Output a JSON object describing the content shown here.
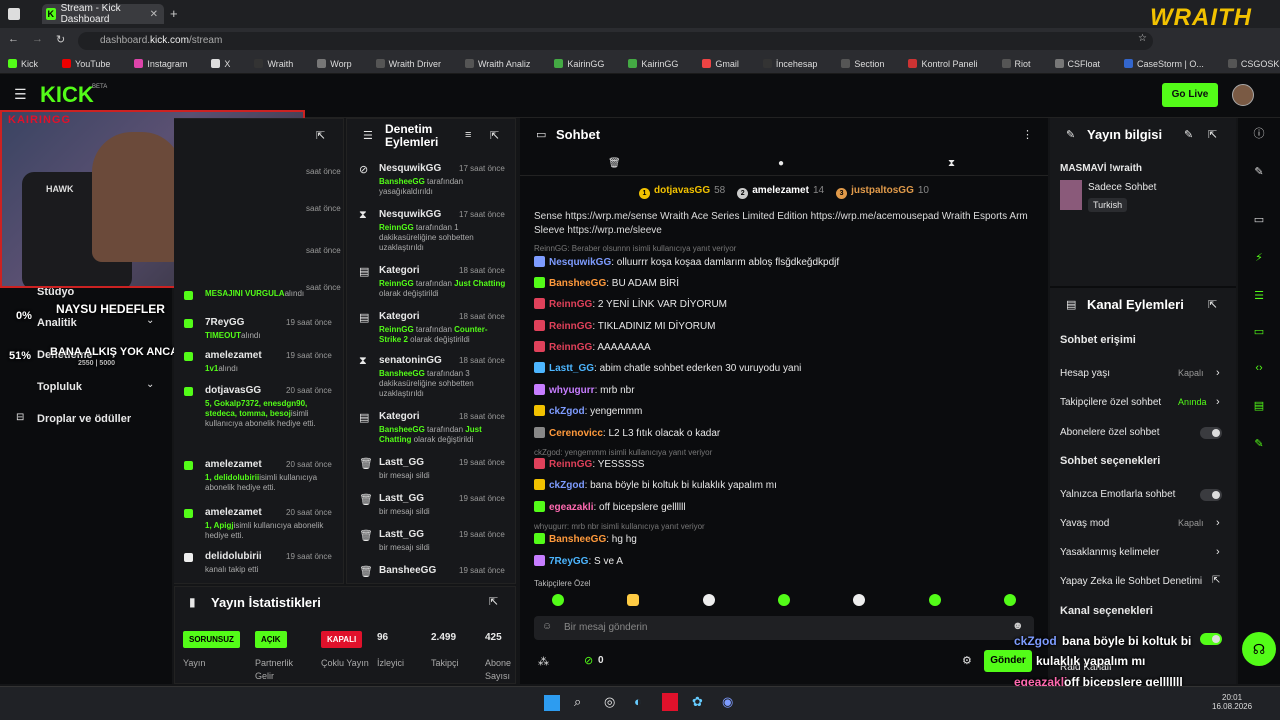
{
  "browser": {
    "tab_title": "Stream - Kick Dashboard",
    "url_prefix": "dashboard.",
    "url_domain": "kick.com",
    "url_path": "/stream",
    "bookmarks": [
      "Kick",
      "YouTube",
      "Instagram",
      "X",
      "Wraith",
      "Worp",
      "Wraith Driver",
      "Wraith Analiz",
      "KairinGG",
      "KairinGG",
      "Gmail",
      "İncehesap",
      "Section",
      "Kontrol Paneli",
      "Riot",
      "CSFloat",
      "CaseStorm | O...",
      "CSGOSKINS.GG",
      "quickabdest",
      "Team Venture |...",
      "Matchmaking"
    ]
  },
  "header": {
    "logo": "KICK",
    "beta": "BETA",
    "go_live": "Go Live",
    "overlay_brand": "WRAITH"
  },
  "cam": {
    "label": "KAIRINGG",
    "hawk": "HAWK"
  },
  "leftnav": {
    "items": [
      {
        "label": "Stüdyo"
      },
      {
        "label": "Analitik"
      },
      {
        "label": "Denetleme"
      },
      {
        "label": "Topluluk"
      },
      {
        "label": "Droplar ve ödüller"
      }
    ],
    "overlay_goals": "NAYSU HEDEFLER",
    "overlay_pct1": "0%",
    "overlay_pct2": "51%",
    "overlay_alkis": "BANA ALKIŞ YOK ANCA KICK",
    "overlay_sub": "2550 | 5000"
  },
  "activity": {
    "rows": [
      {
        "title": "",
        "sub": "MESAJINI VURGULA",
        "sub2": "alındı",
        "time": ""
      },
      {
        "title": "7ReyGG",
        "sub": "TIMEOUT",
        "sub2": "alındı",
        "time": "19 saat önce"
      },
      {
        "title": "amelezamet",
        "sub": "1v1",
        "sub2": "alındı",
        "time": "19 saat önce"
      },
      {
        "title": "dotjavasGG",
        "sub": "5, Gokalp7372, enesdgn90, stedeca, tomma, besoj",
        "sub2": "isimli kullanıcıya abonelik hediye etti.",
        "time": "20 saat önce"
      },
      {
        "title": "amelezamet",
        "sub": "1, delidolubirii",
        "sub2": "isimli kullanıcıya abonelik hediye etti.",
        "time": "20 saat önce"
      },
      {
        "title": "amelezamet",
        "sub": "1, Apigj",
        "sub2": "isimli kullanıcıya abonelik hediye etti.",
        "time": "20 saat önce"
      },
      {
        "title": "delidolubirii",
        "sub": "",
        "sub2": "kanalı takip etti",
        "time": "19 saat önce"
      }
    ],
    "partial_times": [
      "saat önce",
      "saat önce",
      "saat önce",
      "saat önce"
    ]
  },
  "modlog": {
    "title": "Denetim Eylemleri",
    "rows": [
      {
        "user": "NesquwikGG",
        "time": "17 saat önce",
        "line1": "BansheeGG",
        "line1b": " tarafından yasağı",
        "line2": "kaldırıldı"
      },
      {
        "user": "NesquwikGG",
        "time": "17 saat önce",
        "line1": "ReinnGG",
        "line1b": " tarafından 1 dakika",
        "line2": "süreliğine sohbetten uzaklaştırıldı"
      },
      {
        "user": "Kategori",
        "time": "18 saat önce",
        "line1": "ReinnGG",
        "line1b": " tarafından ",
        "line1c": "Just Chatting",
        "line2": " olarak değiştirildi"
      },
      {
        "user": "Kategori",
        "time": "18 saat önce",
        "line1": "ReinnGG",
        "line1b": " tarafından ",
        "line1c": "Counter-Strike 2",
        "line2": " olarak değiştirildi"
      },
      {
        "user": "senatoninGG",
        "time": "18 saat önce",
        "line1": "BansheeGG",
        "line1b": " tarafından 3 dakika",
        "line2": "süreliğine sohbetten uzaklaştırıldı"
      },
      {
        "user": "Kategori",
        "time": "18 saat önce",
        "line1": "BansheeGG",
        "line1b": " tarafından ",
        "line1c": "Just Chatting",
        "line2": " olarak değiştirildi"
      },
      {
        "user": "Lastt_GG",
        "time": "19 saat önce",
        "line1": "",
        "line1b": "bir mesajı sildi",
        "line2": ""
      },
      {
        "user": "Lastt_GG",
        "time": "19 saat önce",
        "line1": "",
        "line1b": "bir mesajı sildi",
        "line2": ""
      },
      {
        "user": "Lastt_GG",
        "time": "19 saat önce",
        "line1": "",
        "line1b": "bir mesajı sildi",
        "line2": ""
      },
      {
        "user": "BansheeGG",
        "time": "19 saat önce",
        "line1": "",
        "line1b": "",
        "line2": ""
      }
    ]
  },
  "stats": {
    "title": "Yayın İstatistikleri",
    "items": [
      {
        "pill": "SORUNSUZ",
        "label": "Yayın",
        "color": "#53fc18"
      },
      {
        "pill": "AÇIK",
        "label": "Partnerlik Gelir",
        "color": "#53fc18"
      },
      {
        "pill": "KAPALI",
        "label": "Çoklu Yayın",
        "color": "#e0112b"
      },
      {
        "val": "96",
        "label": "İzleyici"
      },
      {
        "val": "2.499",
        "label": "Takipçi"
      },
      {
        "val": "425",
        "label": "Abone Sayısı"
      }
    ]
  },
  "chat": {
    "title": "Sohbet",
    "top_gifters": [
      {
        "name": "dotjavasGG",
        "n": "58"
      },
      {
        "name": "amelezamet",
        "n": "14"
      },
      {
        "name": "justpaltosGG",
        "n": "10"
      }
    ],
    "pinned": "Sense https://wrp.me/sense Wraith Ace Series Limited Edition https://wrp.me/acemousepad Wraith Esports Arm Sleeve https://wrp.me/sleeve",
    "messages": [
      {
        "type": "reply",
        "text": "ReinnGG: Beraber olsunnn isimli kullanıcıya yanıt veriyor"
      },
      {
        "type": "msg",
        "user": "NesquwikGG",
        "color": "#7e9cff",
        "text": ": olluurrr koşa koşaa damlarım abloş flsğdkeğdkpdjf"
      },
      {
        "type": "msg",
        "user": "BansheeGG",
        "color": "#ff9a3c",
        "text": ": BU ADAM BİRİ"
      },
      {
        "type": "msg",
        "user": "ReinnGG",
        "color": "#e0415a",
        "text": ": 2 YENİ LİNK VAR DİYORUM"
      },
      {
        "type": "msg",
        "user": "ReinnGG",
        "color": "#e0415a",
        "text": ": TIKLADINIZ MI DİYORUM"
      },
      {
        "type": "msg",
        "user": "ReinnGG",
        "color": "#e0415a",
        "text": ": AAAAAAAA"
      },
      {
        "type": "msg",
        "user": "Lastt_GG",
        "color": "#4db6ff",
        "text": ": abim chatle sohbet ederken 30 vuruyodu yani"
      },
      {
        "type": "msg",
        "user": "whyugurr",
        "color": "#c77dff",
        "text": ": mrb nbr"
      },
      {
        "type": "msg",
        "user": "ckZgod",
        "color": "#7e9cff",
        "text": ": yengemmm"
      },
      {
        "type": "msg",
        "user": "Cerenovicc",
        "color": "#ff9a3c",
        "text": ": L2 L3 fıtık olacak o kadar"
      },
      {
        "type": "reply",
        "text": "ckZgod: yengemmm isimli kullanıcıya yanıt veriyor"
      },
      {
        "type": "msg",
        "user": "ReinnGG",
        "color": "#e0415a",
        "text": ": YESSSSS"
      },
      {
        "type": "msg",
        "user": "ckZgod",
        "color": "#7e9cff",
        "text": ": bana böyle bi koltuk bi kulaklık yapalım mı"
      },
      {
        "type": "msg",
        "user": "egeazakli",
        "color": "#ff6ab0",
        "text": ": off bicepslere gellllll"
      },
      {
        "type": "reply",
        "text": "whyugurr: mrb nbr isimli kullanıcıya yanıt veriyor"
      },
      {
        "type": "msg",
        "user": "BansheeGG",
        "color": "#ff9a3c",
        "text": ": hg hg"
      },
      {
        "type": "msg",
        "user": "7ReyGG",
        "color": "#4db6ff",
        "text": ": S ve A"
      }
    ],
    "followers_only": "Takipçilere Özel",
    "input_placeholder": "Bir mesaj gönderin",
    "points": "0",
    "send": "Gönder"
  },
  "info": {
    "title": "Yayın bilgisi",
    "stream_title": "MASMAVİ !wraith",
    "category": "Sadece Sohbet",
    "lang": "Turkish"
  },
  "channel_actions": {
    "title": "Kanal Eylemleri",
    "access_h": "Sohbet erişimi",
    "rows": [
      {
        "label": "Hesap yaşı",
        "val": "Kapalı"
      },
      {
        "label": "Takipçilere özel sohbet",
        "val": "Anında"
      },
      {
        "label": "Abonelere özel sohbet",
        "val": ""
      }
    ],
    "options_h": "Sohbet seçenekleri",
    "rows2": [
      {
        "label": "Yalnızca Emotlarla sohbet",
        "val": ""
      },
      {
        "label": "Yavaş mod",
        "val": "Kapalı"
      },
      {
        "label": "Yasaklanmış kelimeler",
        "val": ""
      },
      {
        "label": "Yapay Zeka ile Sohbet Denetimi",
        "val": ""
      }
    ],
    "channel_h": "Kanal seçenekleri",
    "partial": "Raid Kanalı"
  },
  "overlay_chat": [
    {
      "user": "ckZgod",
      "text": "bana böyle bi koltuk bi"
    },
    {
      "user": "",
      "text": "kulaklık yapalım mı"
    },
    {
      "user": "egeazakli",
      "text": "off bicepslere gelllllll"
    },
    {
      "user": "7ReyGG",
      "text": "S ve A"
    }
  ],
  "clock": {
    "time": "20:01",
    "date": "16.08.2026"
  }
}
